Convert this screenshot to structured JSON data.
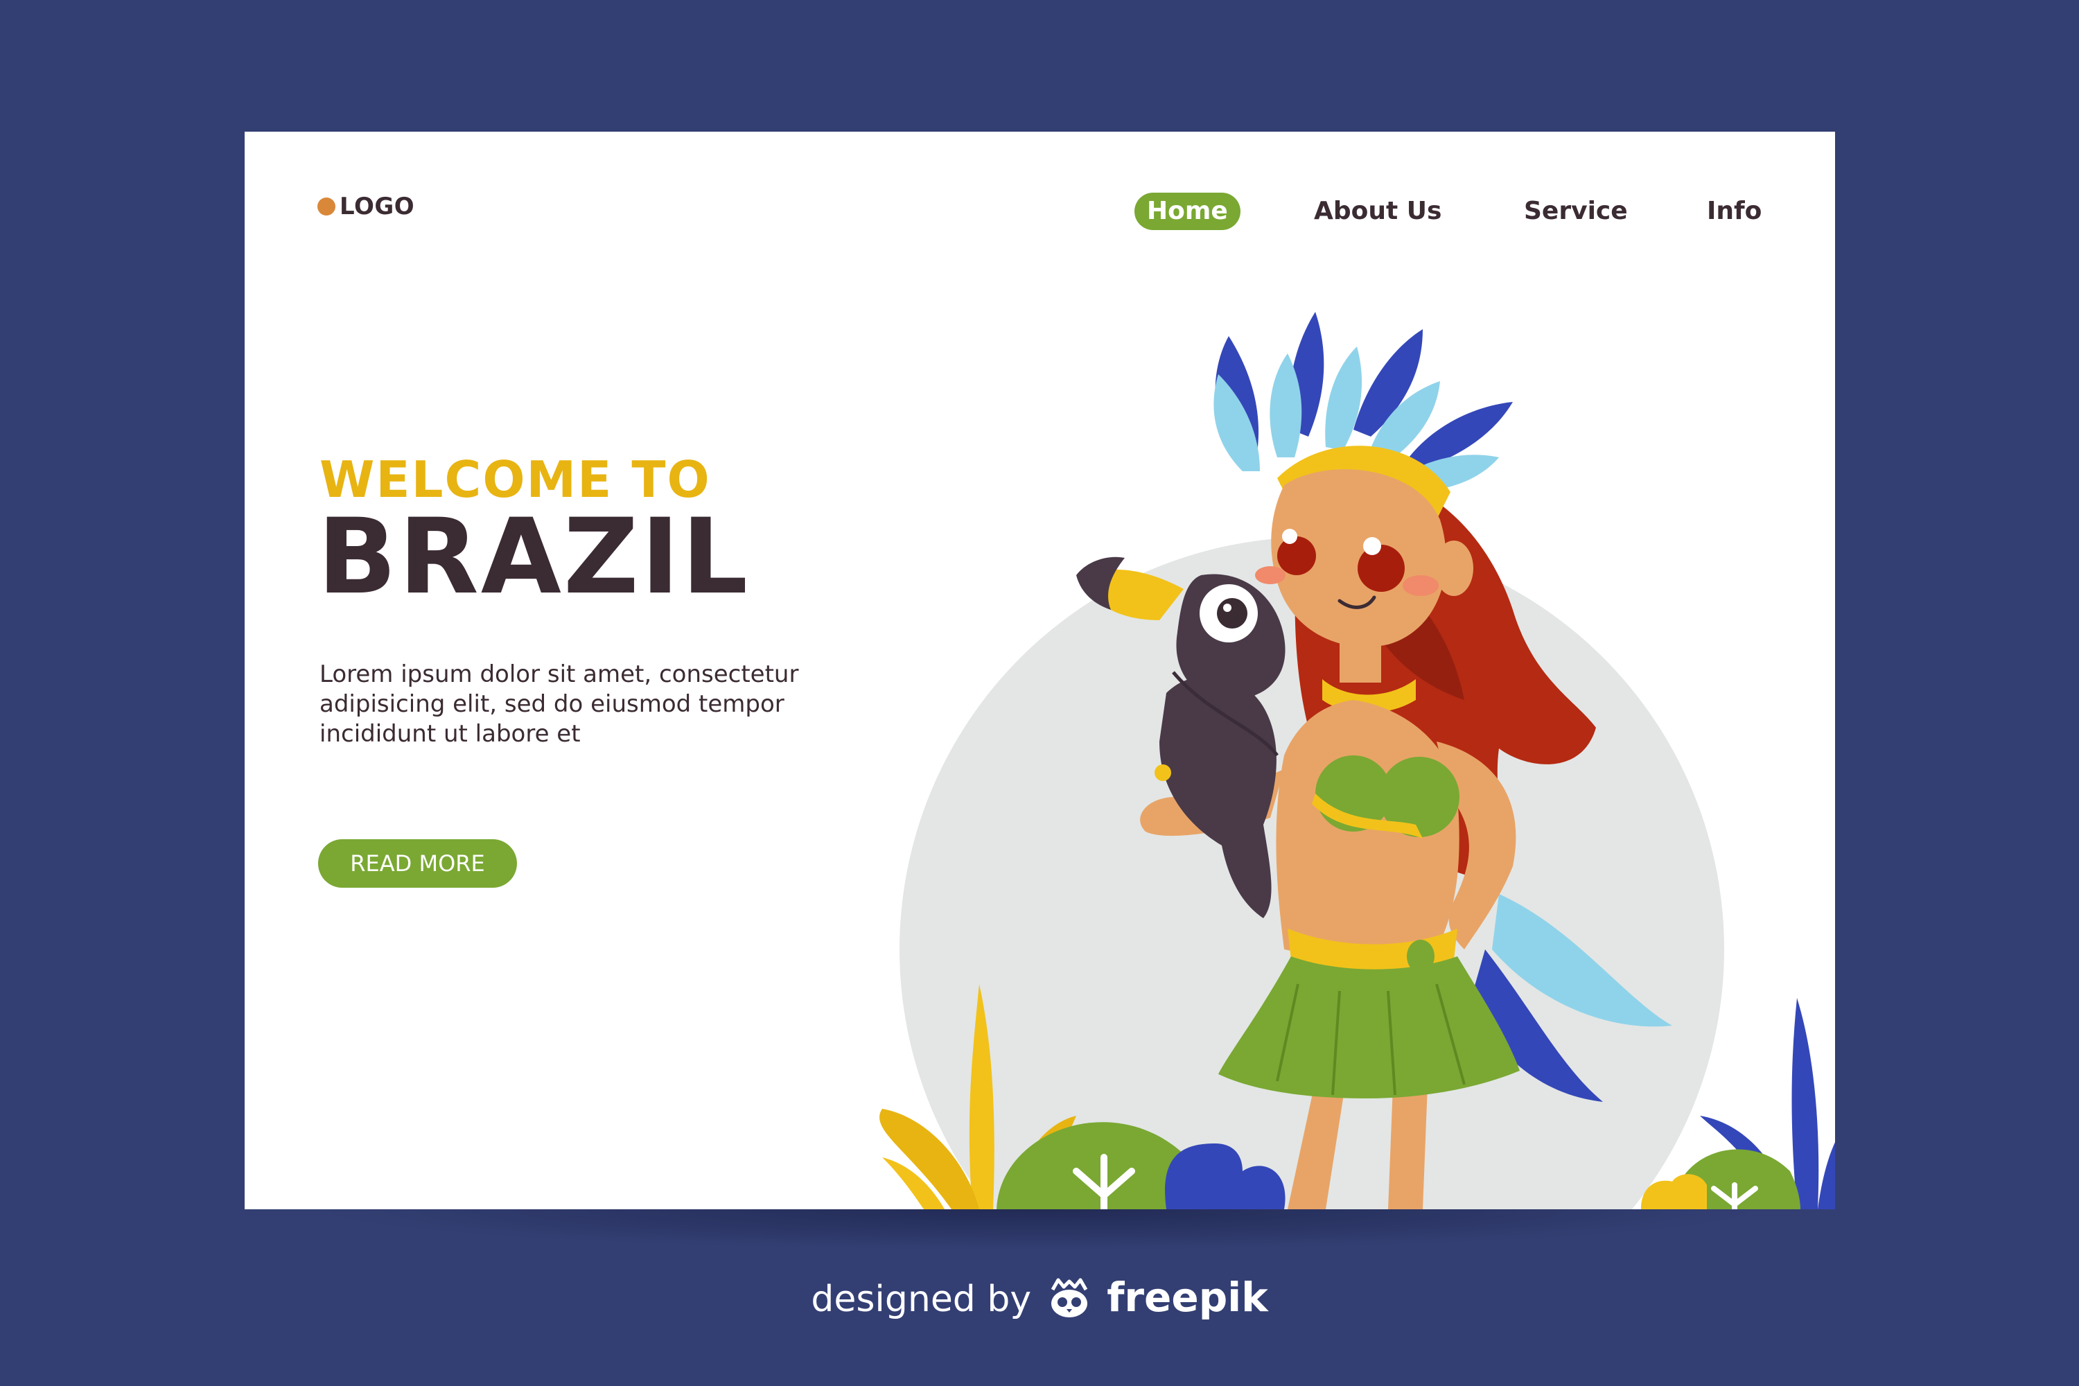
{
  "header": {
    "logo": {
      "label": "LOGO",
      "dot_color": "#d9883a"
    },
    "nav": [
      {
        "label": "Home",
        "active": true
      },
      {
        "label": "About Us",
        "active": false
      },
      {
        "label": "Service",
        "active": false
      },
      {
        "label": "Info",
        "active": false
      }
    ]
  },
  "hero": {
    "kicker": "WELCOME TO",
    "title": "BRAZIL",
    "body": "Lorem ipsum dolor sit amet, consectetur adipisicing elit, sed do eiusmod tempor incididunt ut labore et",
    "cta_label": "READ MORE"
  },
  "credit": {
    "prefix": "designed by",
    "brand": "freepik",
    "icon": "freepik-owl-icon"
  },
  "colors": {
    "background": "#333f73",
    "card": "#ffffff",
    "accent_green": "#7aa833",
    "accent_yellow": "#e8b412",
    "text_dark": "#3b2b33"
  }
}
